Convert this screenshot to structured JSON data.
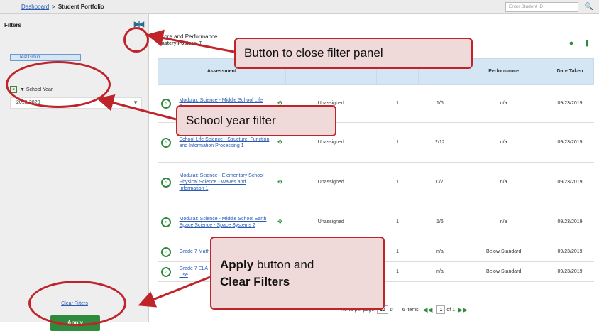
{
  "breadcrumb": {
    "dashboard": "Dashboard",
    "sep": ">",
    "current": "Student Portfolio"
  },
  "search": {
    "placeholder": "Enter Student ID",
    "icon": "search-icon"
  },
  "sidebar": {
    "title": "Filters",
    "test_group": "Test Group",
    "school_year_label": "School Year",
    "school_year_value": "2019-2020",
    "clear_filters": "Clear Filters",
    "apply": "Apply"
  },
  "main": {
    "title": "Score and Performance",
    "sub_label": "Mastery Posters:",
    "sub_value": "T"
  },
  "table": {
    "headers": {
      "assessment": "Assessment",
      "performance": "Performance",
      "date_taken": "Date Taken"
    },
    "rows": [
      {
        "name": "Modular: Science - Middle School Life Science",
        "status": "Unassigned",
        "attempts": "1",
        "score": "1/6",
        "performance": "n/a",
        "date": "09/23/2019"
      },
      {
        "name": "School Life Science - Structure, Function and Information Processing 1",
        "status": "Unassigned",
        "attempts": "1",
        "score": "2/12",
        "performance": "n/a",
        "date": "09/23/2019"
      },
      {
        "name": "Modular: Science - Elementary School Physical Science - Waves and Information 1",
        "status": "Unassigned",
        "attempts": "1",
        "score": "0/7",
        "performance": "n/a",
        "date": "09/23/2019"
      },
      {
        "name": "Modular: Science - Middle School Earth Space Science - Space Systems 2",
        "status": "Unassigned",
        "attempts": "1",
        "score": "1/6",
        "performance": "n/a",
        "date": "09/23/2019"
      },
      {
        "name": "Grade 7 Math - Geometry Figures (IAB)",
        "status": "",
        "attempts": "1",
        "score": "n/a",
        "performance": "Below Standard",
        "date": "09/23/2019"
      },
      {
        "name": "Grade 7 ELA - Language and Vocabulary Use",
        "status": "",
        "attempts": "1",
        "score": "n/a",
        "performance": "Below Standard",
        "date": "09/23/2019"
      }
    ]
  },
  "pager": {
    "rows_per_page_label": "Rows per page:",
    "rows_per_page": "10",
    "items": "6 Items:",
    "page": "1",
    "of": "of 1"
  },
  "callouts": {
    "close_filter": "Button to close filter panel",
    "school_year": "School year filter",
    "apply_line1_bold": "Apply",
    "apply_line1_rest": " button and",
    "apply_line2": "Clear Filters"
  },
  "colors": {
    "accent_red": "#c0242b",
    "callout_bg": "#f0d9d9",
    "green": "#2e8b3d",
    "header_blue": "#d4e6f4"
  }
}
